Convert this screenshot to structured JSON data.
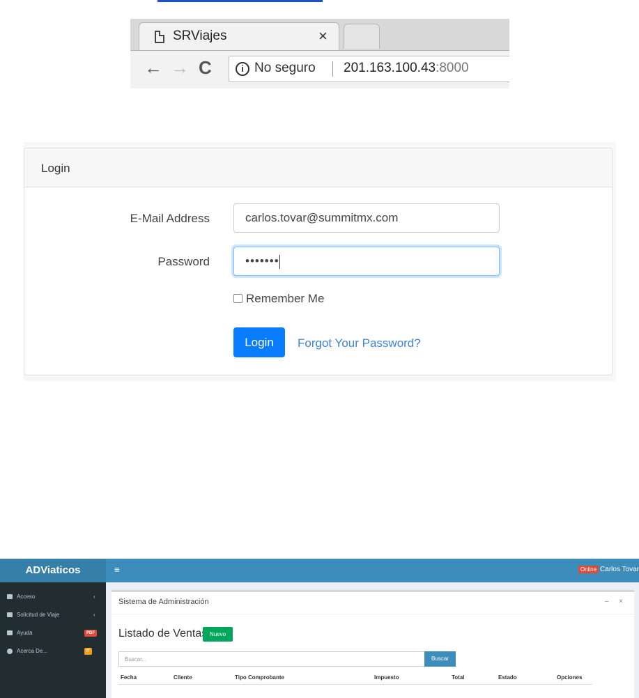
{
  "browser": {
    "tab_title": "SRViajes",
    "tab_close": "×",
    "back": "←",
    "forward": "→",
    "reload": "C",
    "info_icon": "i",
    "security_label": "No seguro",
    "url_host": "201.163.100.43",
    "url_port": ":8000"
  },
  "login": {
    "header": "Login",
    "email_label": "E-Mail Address",
    "email_value": "carlos.tovar@summitmx.com",
    "password_label": "Password",
    "password_value": "•••••••",
    "remember_label": "Remember Me",
    "login_button": "Login",
    "forgot_link": "Forgot Your Password?",
    "colors": {
      "primary": "#0a7dfe",
      "link": "#3b84d8",
      "focus": "#80bdff"
    }
  },
  "admin": {
    "logo": "ADViaticos",
    "hamburger": "≡",
    "online_badge": "Online",
    "user_name": "Carlos Tovar",
    "sidebar": {
      "items": [
        {
          "label": "Acceso",
          "arrow": "‹"
        },
        {
          "label": "Solicitud de Viaje",
          "arrow": "‹"
        },
        {
          "label": "Ayuda",
          "badge": "PDF"
        },
        {
          "label": "Acerca De...",
          "badge": "IT"
        }
      ]
    },
    "box_title": "Sistema de Administración",
    "box_tools": "– ×",
    "list_title": "Listado de Ventas",
    "new_button": "Nuevo",
    "search_placeholder": "Buscar...",
    "search_button": "Buscar",
    "table_headers": [
      "Fecha",
      "Cliente",
      "Tipo Comprobante",
      "Impuesto",
      "Total",
      "Estado",
      "Opciones"
    ],
    "colors": {
      "header": "#3c8dbc",
      "logo_bg": "#367fa9",
      "sidebar": "#222d32",
      "success": "#00a65a",
      "danger": "#dd4b39",
      "warning": "#f39c12"
    }
  }
}
